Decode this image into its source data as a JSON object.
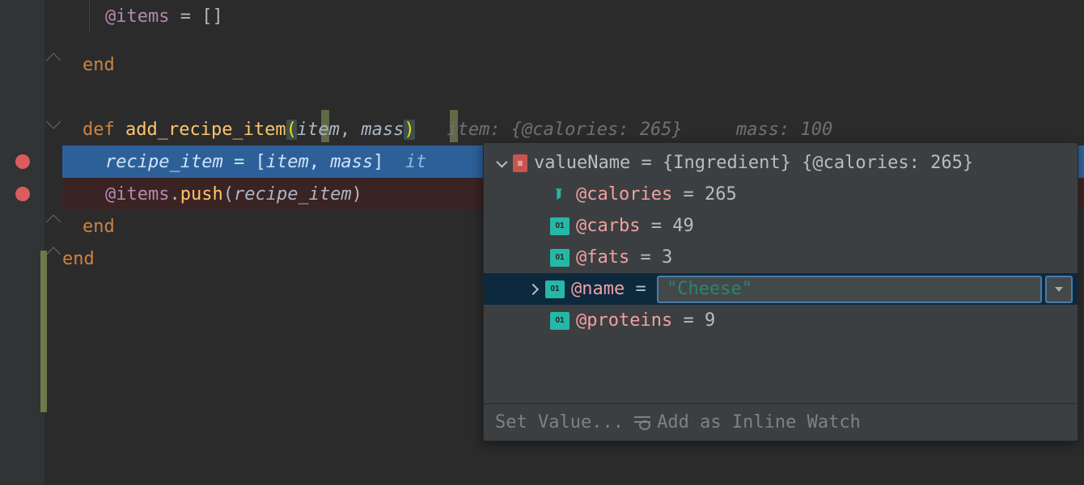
{
  "code": {
    "line1": {
      "ivar": "@items",
      "eq": " = ",
      "brackets": "[]"
    },
    "line2": {
      "end": "end"
    },
    "line4": {
      "def": "def ",
      "method": "add_recipe_item",
      "open": "(",
      "p1": "item",
      "comma": ", ",
      "p2": "mass",
      "close": ")",
      "hint": "   item: {@calories: 265}     mass: 100"
    },
    "line5": {
      "var": "recipe_item",
      "eq": " = ",
      "open": "[",
      "p1": "item",
      "comma": ", ",
      "p2": "mass",
      "close": "]",
      "hint": "  it"
    },
    "line6": {
      "ivar": "@items",
      "dot": ".",
      "method": "push",
      "open": "(",
      "arg": "recipe_item",
      "close": ")"
    },
    "line7": {
      "end": "end"
    },
    "line8": {
      "end": "end"
    }
  },
  "tooltip": {
    "root": {
      "name_label": "valueName",
      "eq": " = ",
      "type": "{Ingredient} ",
      "value": "{@calories: 265}"
    },
    "fields": {
      "calories": {
        "name": "@calories",
        "eq": " = ",
        "val": "265"
      },
      "carbs": {
        "name": "@carbs",
        "eq": " = ",
        "val": "49"
      },
      "fats": {
        "name": "@fats",
        "eq": " = ",
        "val": "3"
      },
      "name": {
        "name": "@name",
        "eq": " = ",
        "val": "\"Cheese\""
      },
      "proteins": {
        "name": "@proteins",
        "eq": " = ",
        "val": "9"
      }
    },
    "footer": {
      "set_value": "Set Value... ",
      "inline_watch": "Add as Inline Watch"
    }
  }
}
